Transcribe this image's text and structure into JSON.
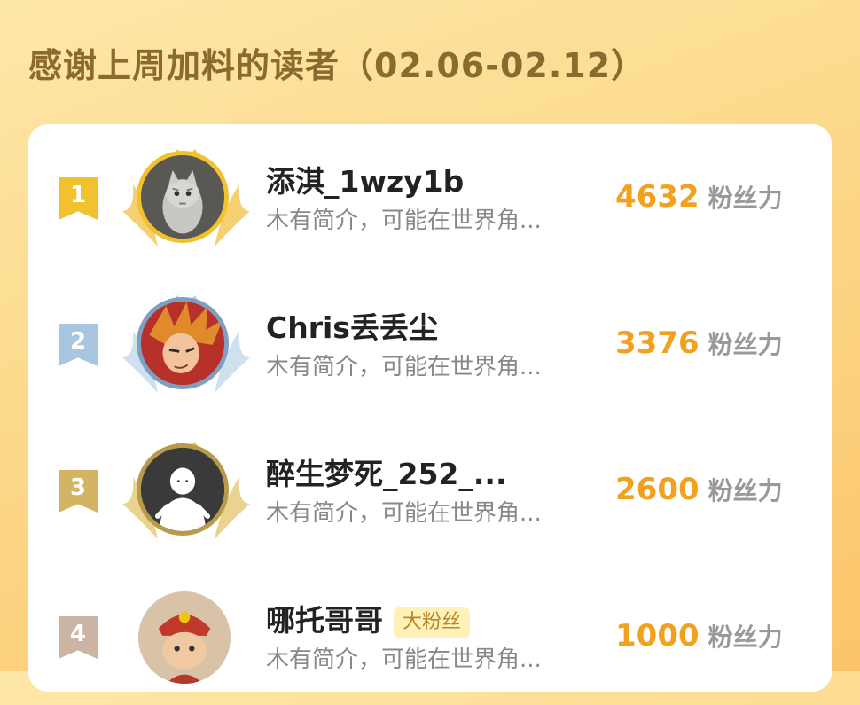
{
  "header": {
    "title": "感谢上周加料的读者（02.06-02.12）"
  },
  "colors": {
    "gold": "#f2c12e",
    "silver": "#a9c6e0",
    "bronze": "#d2b463",
    "rank4": "#cdb5a5",
    "score": "#f2a11f",
    "tag_bg": "#fff1b8"
  },
  "readers": [
    {
      "rank": "1",
      "name": "添淇_1wzy1b",
      "tag": "",
      "bio": "木有简介，可能在世界角...",
      "score": "4632",
      "score_unit": "粉丝力",
      "avatar_icon": "cat-avatar-icon"
    },
    {
      "rank": "2",
      "name": "Chris丢丢尘",
      "tag": "",
      "bio": "木有简介，可能在世界角...",
      "score": "3376",
      "score_unit": "粉丝力",
      "avatar_icon": "anime-avatar-icon"
    },
    {
      "rank": "3",
      "name": "醉生梦死_252_...",
      "tag": "",
      "bio": "木有简介，可能在世界角...",
      "score": "2600",
      "score_unit": "粉丝力",
      "avatar_icon": "default-person-avatar-icon"
    },
    {
      "rank": "4",
      "name": "哪托哥哥",
      "tag": "大粉丝",
      "bio": "木有简介，可能在世界角...",
      "score": "1000",
      "score_unit": "粉丝力",
      "avatar_icon": "cat-costume-avatar-icon"
    }
  ]
}
